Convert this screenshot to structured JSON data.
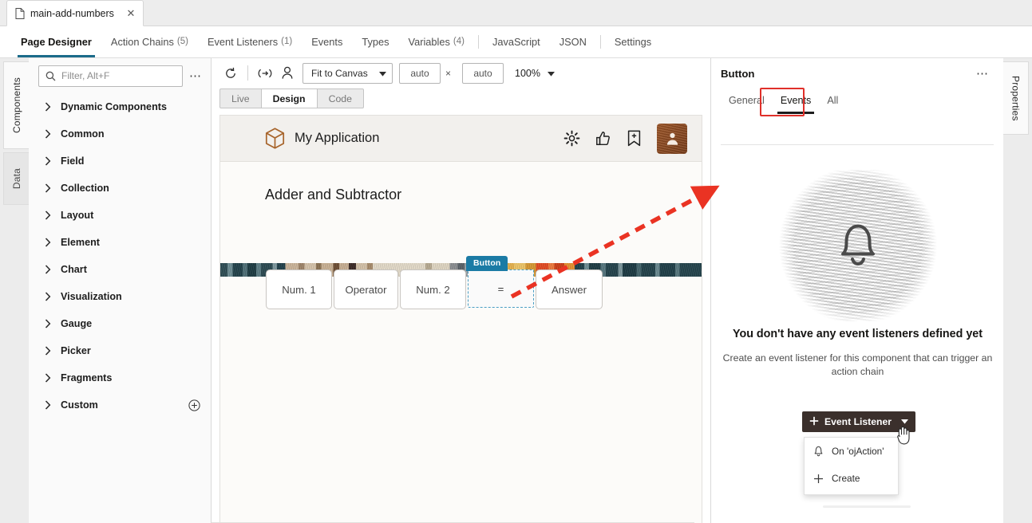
{
  "file_tab": {
    "label": "main-add-numbers",
    "icon": "document-icon",
    "close_icon": "close-icon"
  },
  "nav_tabs": [
    {
      "label": "Page Designer",
      "count": "",
      "active": true
    },
    {
      "label": "Action Chains",
      "count": "(5)",
      "active": false
    },
    {
      "label": "Event Listeners",
      "count": "(1)",
      "active": false
    },
    {
      "label": "Events",
      "count": "",
      "active": false
    },
    {
      "label": "Types",
      "count": "",
      "active": false
    },
    {
      "label": "Variables",
      "count": "(4)",
      "active": false
    },
    {
      "label": "JavaScript",
      "count": "",
      "active": false
    },
    {
      "label": "JSON",
      "count": "",
      "active": false
    },
    {
      "label": "Settings",
      "count": "",
      "active": false
    }
  ],
  "left_rail": [
    {
      "label": "Components",
      "active": true
    },
    {
      "label": "Data",
      "active": false
    }
  ],
  "components_panel": {
    "search": {
      "placeholder": "Filter, Alt+F",
      "value": "",
      "icon": "search-icon"
    },
    "overflow_icon": "more-options-icon",
    "items": [
      {
        "label": "Dynamic Components",
        "has_add": false
      },
      {
        "label": "Common",
        "has_add": false
      },
      {
        "label": "Field",
        "has_add": false
      },
      {
        "label": "Collection",
        "has_add": false
      },
      {
        "label": "Layout",
        "has_add": false
      },
      {
        "label": "Element",
        "has_add": false
      },
      {
        "label": "Chart",
        "has_add": false
      },
      {
        "label": "Visualization",
        "has_add": false
      },
      {
        "label": "Gauge",
        "has_add": false
      },
      {
        "label": "Picker",
        "has_add": false
      },
      {
        "label": "Fragments",
        "has_add": false
      },
      {
        "label": "Custom",
        "has_add": true
      }
    ]
  },
  "canvas_toolbar": {
    "refresh_icon": "refresh-icon",
    "responsive_icon": "responsive-preview-icon",
    "user_icon": "user-icon",
    "fit_select": {
      "value": "Fit to Canvas",
      "chevron": "chevron-down-icon"
    },
    "width_input": {
      "value": "auto"
    },
    "times_symbol": "×",
    "height_input": {
      "value": "auto"
    },
    "zoom": {
      "value": "100%",
      "chevron": "chevron-down-icon"
    },
    "modes": [
      {
        "label": "Live",
        "active": false
      },
      {
        "label": "Design",
        "active": true
      },
      {
        "label": "Code",
        "active": false
      }
    ]
  },
  "app_preview": {
    "logo_icon": "cube-logo-icon",
    "title": "My Application",
    "header_icons": [
      {
        "name": "gear-icon"
      },
      {
        "name": "thumbs-up-icon"
      },
      {
        "name": "bookmark-add-icon"
      }
    ],
    "avatar_name": "avatar",
    "page_title": "Adder and Subtractor",
    "selection_badge": "Button",
    "fields": [
      {
        "label": "Num. 1",
        "type": "input"
      },
      {
        "label": "Operator",
        "type": "input"
      },
      {
        "label": "Num. 2",
        "type": "input"
      },
      {
        "label": "=",
        "type": "button",
        "selected": true
      },
      {
        "label": "Answer",
        "type": "input"
      }
    ]
  },
  "right_rail": [
    {
      "label": "Properties",
      "active": true
    }
  ],
  "properties": {
    "title": "Button",
    "overflow_icon": "more-options-icon",
    "tabs": [
      {
        "label": "General",
        "active": false,
        "highlighted": false
      },
      {
        "label": "Events",
        "active": true,
        "highlighted": true
      },
      {
        "label": "All",
        "active": false,
        "highlighted": false
      }
    ],
    "empty_state": {
      "illustration_icon": "bell-icon",
      "heading": "You don't have any event listeners defined yet",
      "description": "Create an event listener for this component that can trigger an action chain"
    },
    "event_listener_button": {
      "plus_icon": "plus-icon",
      "label": "Event Listener",
      "chevron": "chevron-down-icon"
    },
    "event_menu": [
      {
        "icon": "bell-icon",
        "label": "On 'ojAction'"
      },
      {
        "icon": "plus-icon",
        "label": "Create"
      }
    ]
  },
  "annotation": {
    "arrow_color": "#ea3323",
    "highlight_color": "#e0302a"
  }
}
